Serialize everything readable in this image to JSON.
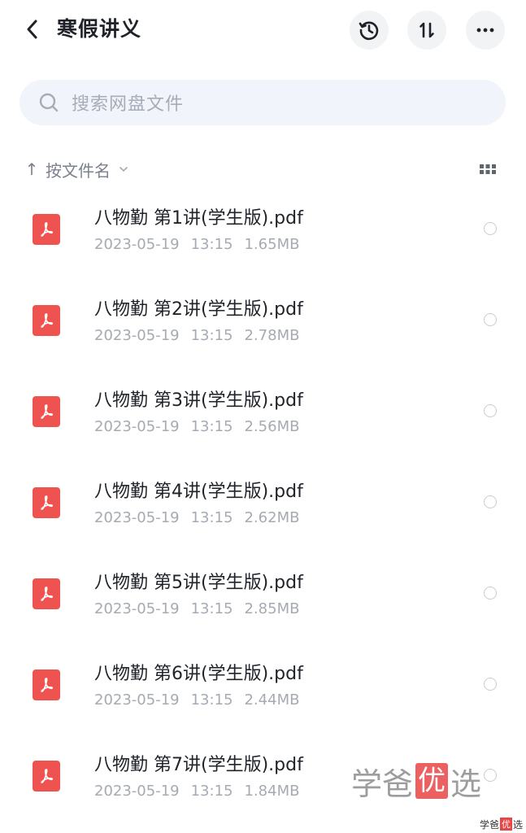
{
  "header": {
    "title": "寒假讲义"
  },
  "search": {
    "placeholder": "搜索网盘文件"
  },
  "sort": {
    "arrow": "↑",
    "label": "按文件名"
  },
  "files": [
    {
      "name": "八物勤 第1讲(学生版).pdf",
      "date": "2023-05-19",
      "time": "13:15",
      "size": "1.65MB"
    },
    {
      "name": "八物勤 第2讲(学生版).pdf",
      "date": "2023-05-19",
      "time": "13:15",
      "size": "2.78MB"
    },
    {
      "name": "八物勤 第3讲(学生版).pdf",
      "date": "2023-05-19",
      "time": "13:15",
      "size": "2.56MB"
    },
    {
      "name": "八物勤 第4讲(学生版).pdf",
      "date": "2023-05-19",
      "time": "13:15",
      "size": "2.62MB"
    },
    {
      "name": "八物勤 第5讲(学生版).pdf",
      "date": "2023-05-19",
      "time": "13:15",
      "size": "2.85MB"
    },
    {
      "name": "八物勤 第6讲(学生版).pdf",
      "date": "2023-05-19",
      "time": "13:15",
      "size": "2.44MB"
    },
    {
      "name": "八物勤 第7讲(学生版).pdf",
      "date": "2023-05-19",
      "time": "13:15",
      "size": "1.84MB"
    }
  ],
  "watermark": {
    "part1": "学爸",
    "highlight": "优",
    "part2": "选"
  },
  "icons": {
    "back": "chevron-left-icon",
    "history": "history-clock-icon",
    "sort_order": "sort-arrows-icon",
    "more": "more-dots-icon",
    "search": "search-icon",
    "grid": "grid-view-icon",
    "file": "pdf-file-icon"
  },
  "colors": {
    "pdf_red": "#ef5350",
    "text_primary": "#1f2329",
    "text_secondary": "#a5aab3",
    "search_bg": "#f1f4fa",
    "watermark_red": "#e84545"
  }
}
